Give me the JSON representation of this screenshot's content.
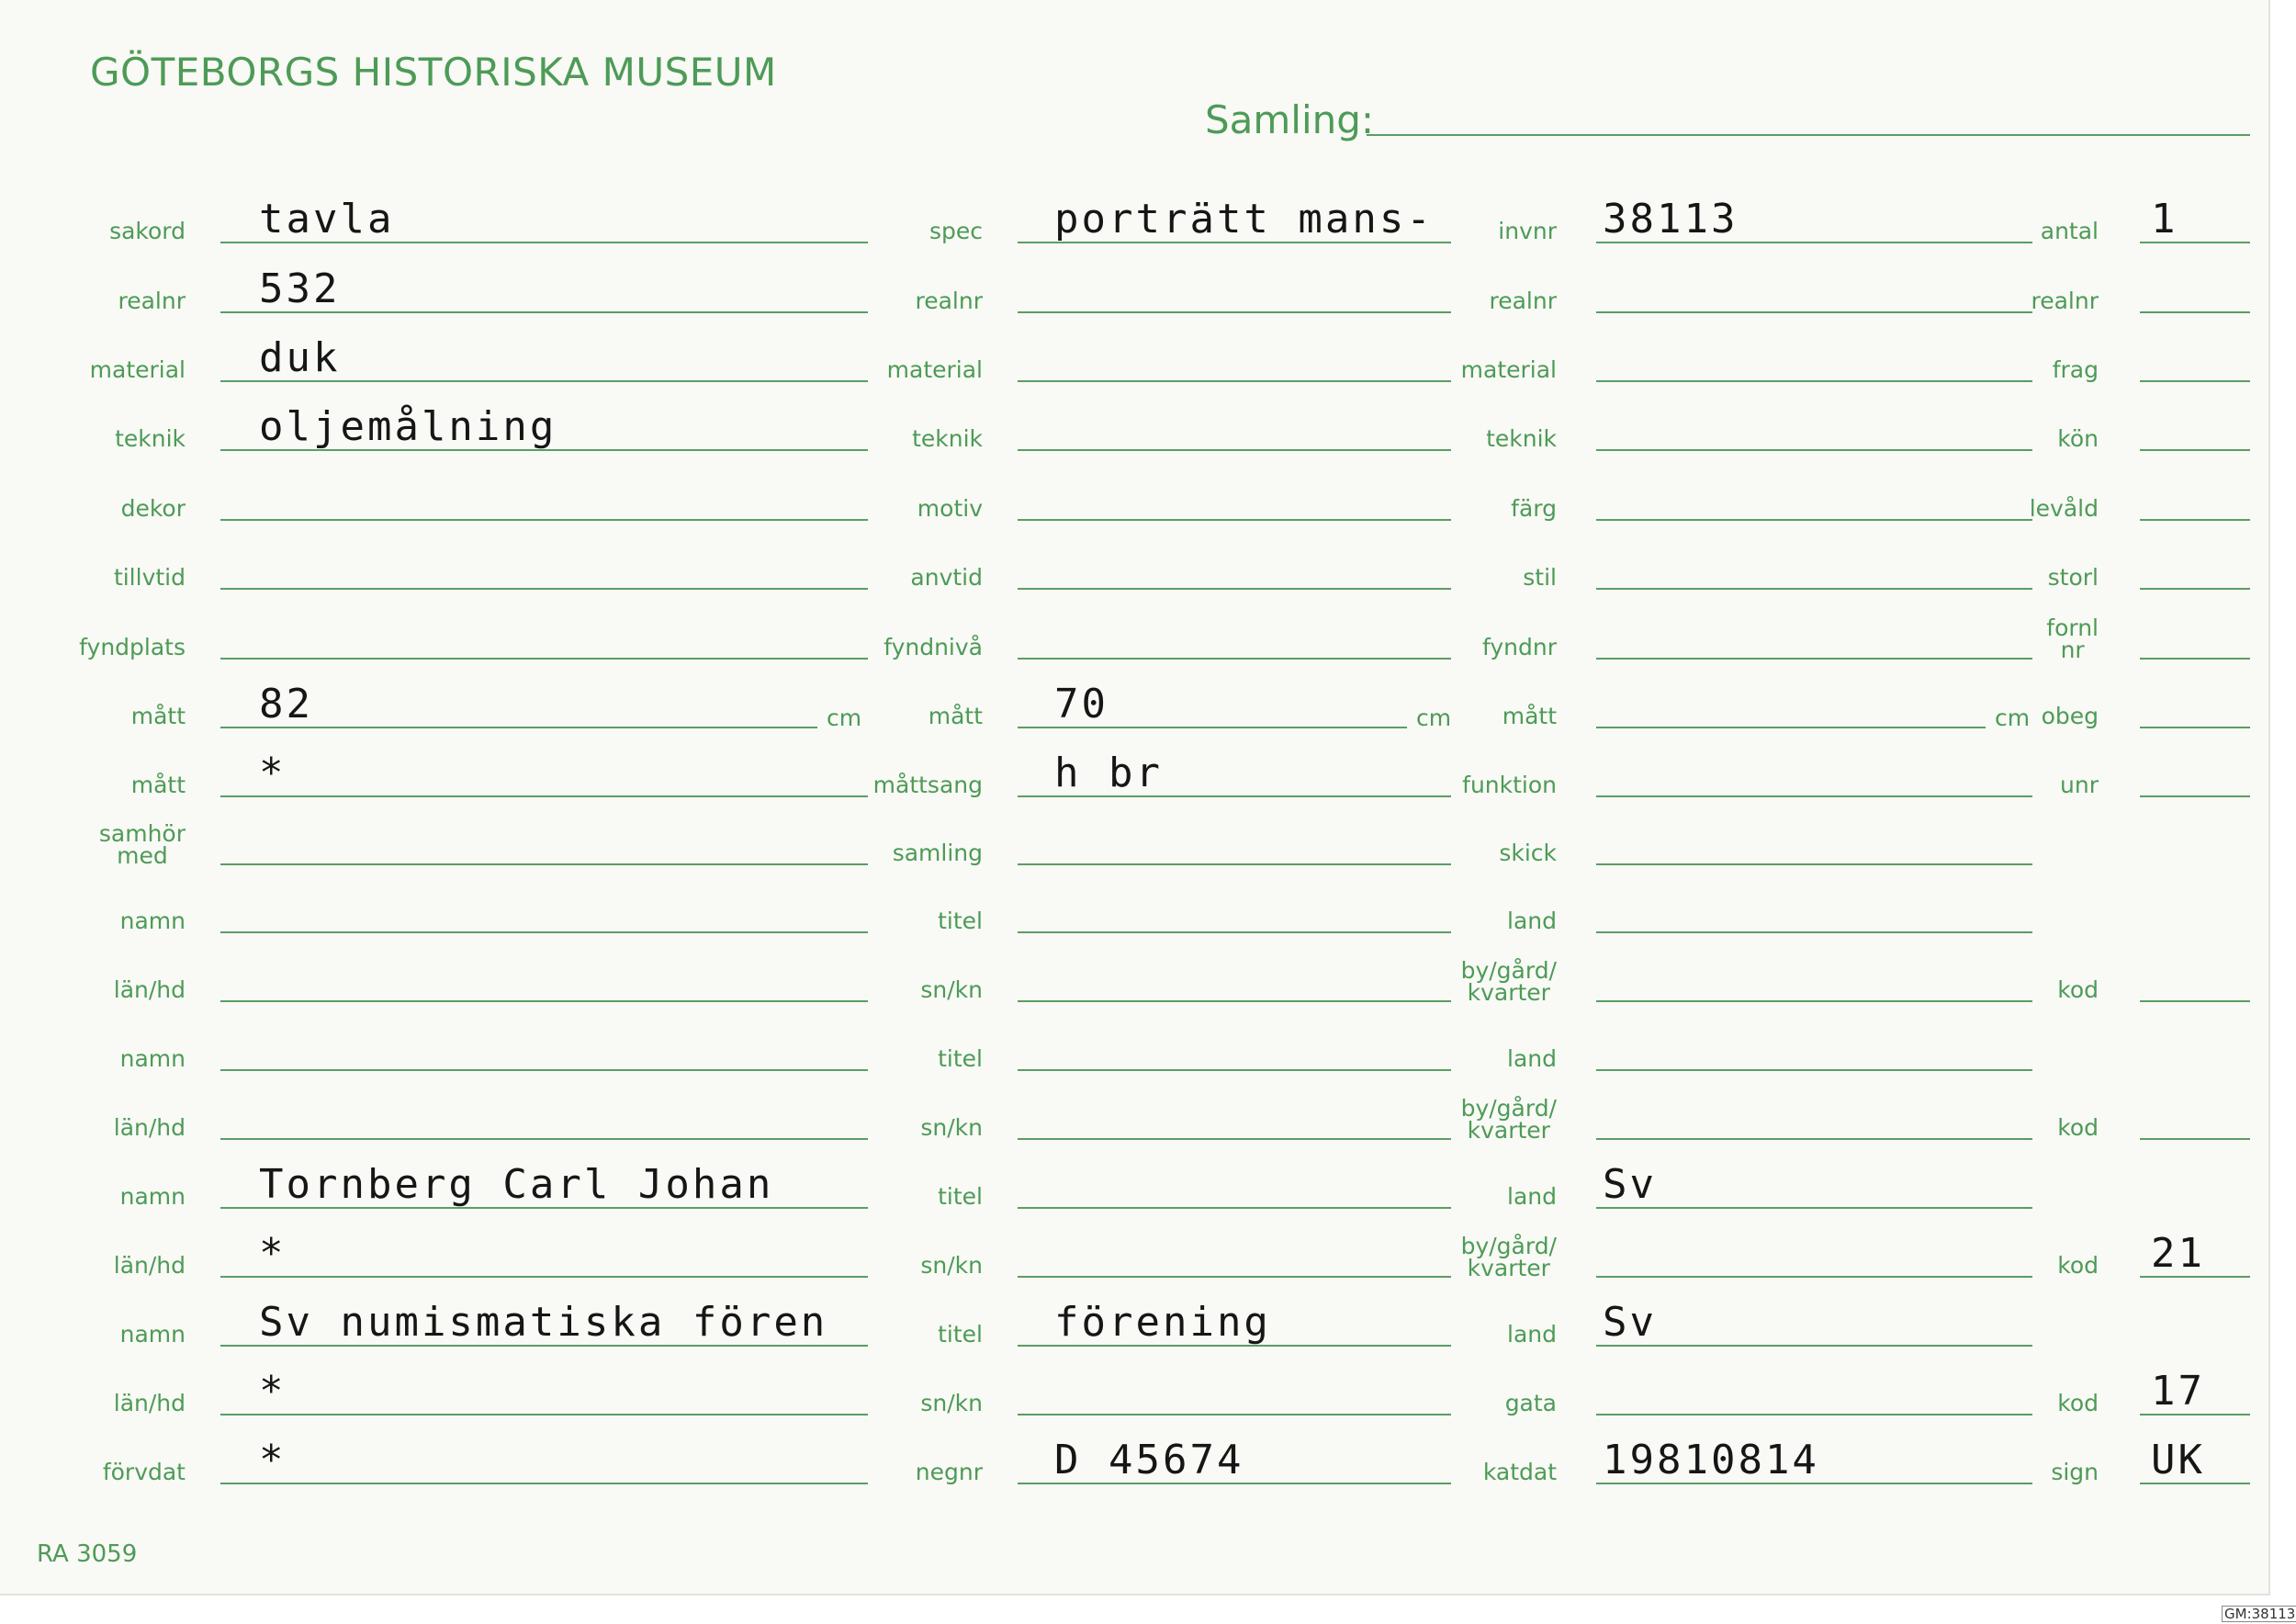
{
  "header": {
    "title": "GÖTEBORGS HISTORISKA MUSEUM",
    "samling_label": "Samling:"
  },
  "columns": [
    {
      "rows": [
        {
          "label": "sakord",
          "value": "tavla"
        },
        {
          "label": "realnr",
          "value": "532"
        },
        {
          "label": "material",
          "value": "duk"
        },
        {
          "label": "teknik",
          "value": "oljemålning"
        },
        {
          "label": "dekor",
          "value": ""
        },
        {
          "label": "tillvtid",
          "value": ""
        },
        {
          "label": "fyndplats",
          "value": ""
        },
        {
          "label": "mått",
          "value": "82",
          "unit": "cm"
        },
        {
          "label": "mått",
          "value": "*"
        },
        {
          "label": "samhör\nmed",
          "value": ""
        },
        {
          "label": "namn",
          "value": ""
        },
        {
          "label": "län/hd",
          "value": ""
        },
        {
          "label": "namn",
          "value": ""
        },
        {
          "label": "län/hd",
          "value": ""
        },
        {
          "label": "namn",
          "value": "Tornberg Carl Johan"
        },
        {
          "label": "län/hd",
          "value": "*"
        },
        {
          "label": "namn",
          "value": "Sv numismatiska fören"
        },
        {
          "label": "län/hd",
          "value": "*"
        },
        {
          "label": "förvdat",
          "value": "*"
        }
      ]
    },
    {
      "rows": [
        {
          "label": "spec",
          "value": "porträtt mans-"
        },
        {
          "label": "realnr",
          "value": ""
        },
        {
          "label": "material",
          "value": ""
        },
        {
          "label": "teknik",
          "value": ""
        },
        {
          "label": "motiv",
          "value": ""
        },
        {
          "label": "anvtid",
          "value": ""
        },
        {
          "label": "fyndnivå",
          "value": ""
        },
        {
          "label": "mått",
          "value": "70",
          "unit": "cm"
        },
        {
          "label": "måttsang",
          "value": "h br"
        },
        {
          "label": "samling",
          "value": ""
        },
        {
          "label": "titel",
          "value": ""
        },
        {
          "label": "sn/kn",
          "value": ""
        },
        {
          "label": "titel",
          "value": ""
        },
        {
          "label": "sn/kn",
          "value": ""
        },
        {
          "label": "titel",
          "value": ""
        },
        {
          "label": "sn/kn",
          "value": ""
        },
        {
          "label": "titel",
          "value": "förening"
        },
        {
          "label": "sn/kn",
          "value": ""
        },
        {
          "label": "negnr",
          "value": "D 45674"
        }
      ]
    },
    {
      "rows": [
        {
          "label": "invnr",
          "value": "38113"
        },
        {
          "label": "realnr",
          "value": ""
        },
        {
          "label": "material",
          "value": ""
        },
        {
          "label": "teknik",
          "value": ""
        },
        {
          "label": "färg",
          "value": ""
        },
        {
          "label": "stil",
          "value": ""
        },
        {
          "label": "fyndnr",
          "value": ""
        },
        {
          "label": "mått",
          "value": "",
          "unit": "cm"
        },
        {
          "label": "funktion",
          "value": ""
        },
        {
          "label": "skick",
          "value": ""
        },
        {
          "label": "land",
          "value": ""
        },
        {
          "label": "by/gård/\nkvarter",
          "value": ""
        },
        {
          "label": "land",
          "value": ""
        },
        {
          "label": "by/gård/\nkvarter",
          "value": ""
        },
        {
          "label": "land",
          "value": "Sv"
        },
        {
          "label": "by/gård/\nkvarter",
          "value": ""
        },
        {
          "label": "land",
          "value": "Sv"
        },
        {
          "label": "gata",
          "value": ""
        },
        {
          "label": "katdat",
          "value": "19810814"
        }
      ]
    },
    {
      "rows": [
        {
          "label": "antal",
          "value": "1"
        },
        {
          "label": "realnr",
          "value": ""
        },
        {
          "label": "frag",
          "value": ""
        },
        {
          "label": "kön",
          "value": ""
        },
        {
          "label": "levåld",
          "value": ""
        },
        {
          "label": "storl",
          "value": ""
        },
        {
          "label": "fornl\nnr",
          "value": ""
        },
        {
          "label": "obeg",
          "value": ""
        },
        {
          "label": "unr",
          "value": ""
        },
        null,
        null,
        {
          "label": "kod",
          "value": ""
        },
        null,
        {
          "label": "kod",
          "value": ""
        },
        null,
        {
          "label": "kod",
          "value": "21"
        },
        null,
        {
          "label": "kod",
          "value": "17"
        },
        {
          "label": "sign",
          "value": "UK"
        }
      ]
    }
  ],
  "footer": {
    "ref": "RA 3059",
    "stamp": "GM:38113"
  }
}
